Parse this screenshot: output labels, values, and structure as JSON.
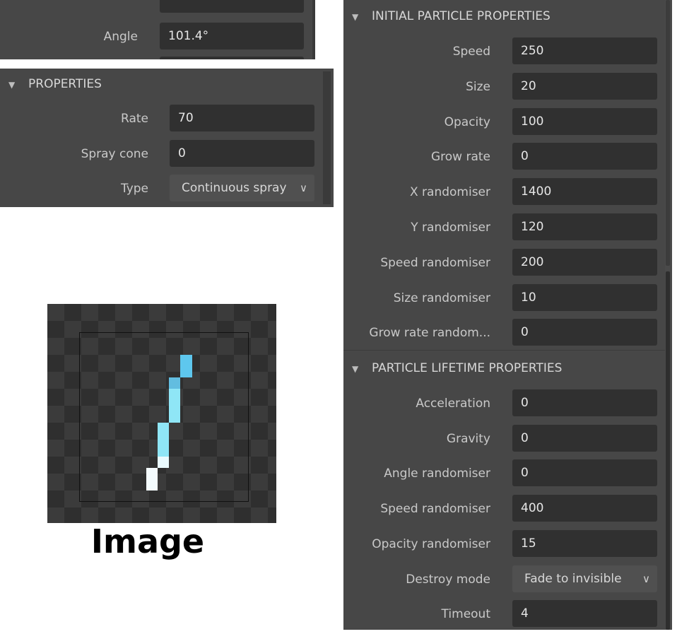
{
  "top_panel": {
    "angle_label": "Angle",
    "angle_value": "101.4°"
  },
  "properties": {
    "header": "PROPERTIES",
    "rate_label": "Rate",
    "rate_value": "70",
    "spray_cone_label": "Spray cone",
    "spray_cone_value": "0",
    "type_label": "Type",
    "type_value": "Continuous spray"
  },
  "image_preview": {
    "caption": "Image"
  },
  "initial": {
    "header": "INITIAL PARTICLE PROPERTIES",
    "rows": [
      {
        "label": "Speed",
        "value": "250"
      },
      {
        "label": "Size",
        "value": "20"
      },
      {
        "label": "Opacity",
        "value": "100"
      },
      {
        "label": "Grow rate",
        "value": "0"
      },
      {
        "label": "X randomiser",
        "value": "1400"
      },
      {
        "label": "Y randomiser",
        "value": "120"
      },
      {
        "label": "Speed randomiser",
        "value": "200"
      },
      {
        "label": "Size randomiser",
        "value": "10"
      },
      {
        "label": "Grow rate random...",
        "value": "0"
      }
    ]
  },
  "lifetime": {
    "header": "PARTICLE LIFETIME PROPERTIES",
    "rows": [
      {
        "label": "Acceleration",
        "value": "0"
      },
      {
        "label": "Gravity",
        "value": "0"
      },
      {
        "label": "Angle randomiser",
        "value": "0"
      },
      {
        "label": "Speed randomiser",
        "value": "400"
      },
      {
        "label": "Opacity randomiser",
        "value": "15"
      },
      {
        "label": "Destroy mode",
        "value": "Fade to invisible"
      },
      {
        "label": "Timeout",
        "value": "4"
      }
    ]
  }
}
